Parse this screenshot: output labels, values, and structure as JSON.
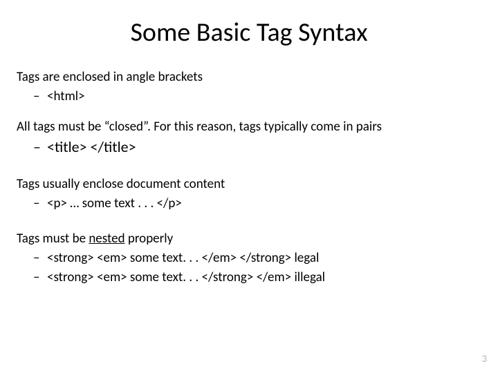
{
  "title": "Some Basic Tag Syntax",
  "section1": {
    "lead": "Tags are enclosed in angle brackets",
    "item": "<html>"
  },
  "section2": {
    "lead": "All tags must be “closed”.  For this reason, tags typically come in pairs",
    "item": "<title> </title>"
  },
  "section3": {
    "lead": "Tags usually enclose document content",
    "item": "<p> … some text . . . </p>"
  },
  "section4": {
    "lead_pre": "Tags must be ",
    "lead_underlined": "nested",
    "lead_post": " properly",
    "item1": "<strong> <em> some text. . . </em> </strong>  legal",
    "item2": "<strong> <em> some text. . . </strong> </em>  illegal"
  },
  "page_number": "3"
}
